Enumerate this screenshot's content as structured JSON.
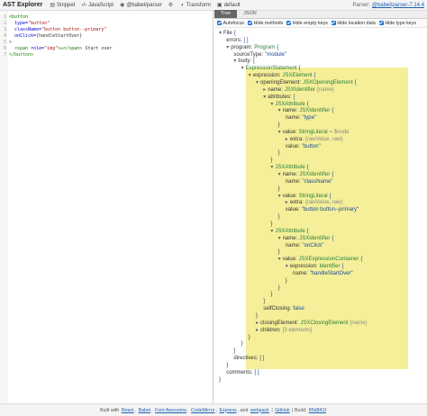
{
  "toolbar": {
    "title": "AST Explorer",
    "snippet": "Snippet",
    "language": "JavaScript",
    "parser_name": "@babel/parser",
    "transform": "Transform",
    "default": "default",
    "parser_label": "Parser:",
    "parser_version": "@babel/parser-7.14.4"
  },
  "editor": {
    "lines": [
      {
        "n": "1",
        "segs": [
          {
            "t": "<button",
            "c": "tag"
          }
        ]
      },
      {
        "n": "2",
        "segs": [
          {
            "t": "  type=",
            "c": "attr"
          },
          {
            "t": "\"button\"",
            "c": "str"
          }
        ]
      },
      {
        "n": "3",
        "segs": [
          {
            "t": "  className=",
            "c": "attr"
          },
          {
            "t": "\"button button--primary\"",
            "c": "str"
          }
        ]
      },
      {
        "n": "4",
        "segs": [
          {
            "t": "  onClick=",
            "c": "attr"
          },
          {
            "t": "{handleStartOver}",
            "c": "brk"
          }
        ]
      },
      {
        "n": "5",
        "segs": [
          {
            "t": ">",
            "c": "tag"
          }
        ]
      },
      {
        "n": "6",
        "segs": [
          {
            "t": "  <span ",
            "c": "tag"
          },
          {
            "t": "role=",
            "c": "attr"
          },
          {
            "t": "\"img\"",
            "c": "str"
          },
          {
            "t": ">↺</span>",
            "c": "tag"
          },
          {
            "t": " Start over",
            "c": "brk"
          }
        ]
      },
      {
        "n": "7",
        "segs": [
          {
            "t": "</button>",
            "c": "tag"
          }
        ]
      }
    ]
  },
  "tabs": {
    "tree": "Tree",
    "json": "JSON"
  },
  "options": [
    "Autofocus",
    "Hide methods",
    "Hide empty keys",
    "Hide location data",
    "Hide type keys"
  ],
  "tree": [
    {
      "d": 0,
      "a": "-",
      "k": "File",
      "t": "",
      "v": "{",
      "m": ""
    },
    {
      "d": 1,
      "a": "",
      "k": "errors:",
      "t": "",
      "v": "[ ]",
      "m": ""
    },
    {
      "d": 1,
      "a": "-",
      "k": "program:",
      "t": "Program",
      "v": "{",
      "m": ""
    },
    {
      "d": 2,
      "a": "",
      "k": "sourceType:",
      "t": "",
      "v": "\"module\"",
      "m": ""
    },
    {
      "d": 2,
      "a": "-",
      "k": "body:",
      "t": "",
      "v": "[",
      "m": ""
    },
    {
      "d": 3,
      "a": "-",
      "k": "",
      "t": "ExpressionStatement",
      "v": "{",
      "m": ""
    },
    {
      "d": 4,
      "a": "-",
      "k": "expression:",
      "t": "JSXElement",
      "v": "{",
      "m": ""
    },
    {
      "d": 5,
      "a": "-",
      "k": "openingElement:",
      "t": "JSXOpeningElement",
      "v": "{",
      "m": ""
    },
    {
      "d": 6,
      "a": "+",
      "k": "name:",
      "t": "JSXIdentifier",
      "v": "",
      "m": "{name}"
    },
    {
      "d": 6,
      "a": "-",
      "k": "attributes:",
      "t": "",
      "v": "[",
      "m": ""
    },
    {
      "d": 7,
      "a": "-",
      "k": "",
      "t": "JSXAttribute",
      "v": "{",
      "m": ""
    },
    {
      "d": 8,
      "a": "-",
      "k": "name:",
      "t": "JSXIdentifier",
      "v": "{",
      "m": ""
    },
    {
      "d": 9,
      "a": "",
      "k": "name:",
      "t": "",
      "v": "\"type\"",
      "m": ""
    },
    {
      "d": 8,
      "a": "",
      "k": "}",
      "t": "",
      "v": "",
      "m": ""
    },
    {
      "d": 8,
      "a": "-",
      "k": "value:",
      "t": "StringLiteral",
      "v": "",
      "m": "= $node"
    },
    {
      "d": 9,
      "a": "+",
      "k": "extra:",
      "t": "",
      "v": "",
      "m": "{rawValue, raw}"
    },
    {
      "d": 9,
      "a": "",
      "k": "value:",
      "t": "",
      "v": "\"button\"",
      "m": ""
    },
    {
      "d": 8,
      "a": "",
      "k": "}",
      "t": "",
      "v": "",
      "m": ""
    },
    {
      "d": 7,
      "a": "",
      "k": "}",
      "t": "",
      "v": "",
      "m": ""
    },
    {
      "d": 7,
      "a": "-",
      "k": "",
      "t": "JSXAttribute",
      "v": "{",
      "m": ""
    },
    {
      "d": 8,
      "a": "-",
      "k": "name:",
      "t": "JSXIdentifier",
      "v": "{",
      "m": ""
    },
    {
      "d": 9,
      "a": "",
      "k": "name:",
      "t": "",
      "v": "\"className\"",
      "m": ""
    },
    {
      "d": 8,
      "a": "",
      "k": "}",
      "t": "",
      "v": "",
      "m": ""
    },
    {
      "d": 8,
      "a": "-",
      "k": "value:",
      "t": "StringLiteral",
      "v": "{",
      "m": ""
    },
    {
      "d": 9,
      "a": "+",
      "k": "extra:",
      "t": "",
      "v": "",
      "m": "{rawValue, raw}"
    },
    {
      "d": 9,
      "a": "",
      "k": "value:",
      "t": "",
      "v": "\"button button--primary\"",
      "m": ""
    },
    {
      "d": 8,
      "a": "",
      "k": "}",
      "t": "",
      "v": "",
      "m": ""
    },
    {
      "d": 7,
      "a": "",
      "k": "}",
      "t": "",
      "v": "",
      "m": ""
    },
    {
      "d": 7,
      "a": "-",
      "k": "",
      "t": "JSXAttribute",
      "v": "{",
      "m": ""
    },
    {
      "d": 8,
      "a": "-",
      "k": "name:",
      "t": "JSXIdentifier",
      "v": "{",
      "m": ""
    },
    {
      "d": 9,
      "a": "",
      "k": "name:",
      "t": "",
      "v": "\"onClick\"",
      "m": ""
    },
    {
      "d": 8,
      "a": "",
      "k": "}",
      "t": "",
      "v": "",
      "m": ""
    },
    {
      "d": 8,
      "a": "-",
      "k": "value:",
      "t": "JSXExpressionContainer",
      "v": "{",
      "m": ""
    },
    {
      "d": 9,
      "a": "-",
      "k": "expression:",
      "t": "Identifier",
      "v": "{",
      "m": ""
    },
    {
      "d": 10,
      "a": "",
      "k": "name:",
      "t": "",
      "v": "\"handleStartOver\"",
      "m": ""
    },
    {
      "d": 9,
      "a": "",
      "k": "}",
      "t": "",
      "v": "",
      "m": ""
    },
    {
      "d": 8,
      "a": "",
      "k": "}",
      "t": "",
      "v": "",
      "m": ""
    },
    {
      "d": 7,
      "a": "",
      "k": "}",
      "t": "",
      "v": "",
      "m": ""
    },
    {
      "d": 6,
      "a": "",
      "k": "]",
      "t": "",
      "v": "",
      "m": ""
    },
    {
      "d": 6,
      "a": "",
      "k": "selfClosing:",
      "t": "",
      "v": "false",
      "m": ""
    },
    {
      "d": 5,
      "a": "",
      "k": "}",
      "t": "",
      "v": "",
      "m": ""
    },
    {
      "d": 5,
      "a": "+",
      "k": "closingElement:",
      "t": "JSXClosingElement",
      "v": "",
      "m": "{name}"
    },
    {
      "d": 5,
      "a": "+",
      "k": "children:",
      "t": "",
      "v": "",
      "m": "[3 elements]"
    },
    {
      "d": 4,
      "a": "",
      "k": "}",
      "t": "",
      "v": "",
      "m": ""
    },
    {
      "d": 3,
      "a": "",
      "k": "}",
      "t": "",
      "v": "",
      "m": ""
    },
    {
      "d": 2,
      "a": "",
      "k": "]",
      "t": "",
      "v": "",
      "m": ""
    },
    {
      "d": 2,
      "a": "",
      "k": "directives:",
      "t": "",
      "v": "[ ]",
      "m": ""
    },
    {
      "d": 1,
      "a": "",
      "k": "}",
      "t": "",
      "v": "",
      "m": ""
    },
    {
      "d": 1,
      "a": "",
      "k": "comments:",
      "t": "",
      "v": "[ ]",
      "m": ""
    },
    {
      "d": 0,
      "a": "",
      "k": "}",
      "t": "",
      "v": "",
      "m": ""
    }
  ],
  "footer": {
    "built_with": "Built with",
    "links": [
      "React",
      "Babel",
      "Font Awesome",
      "CodeMirror",
      "Express",
      "webpack",
      "GitHub",
      "85d841f"
    ],
    "seps": [
      ",",
      ",",
      ",",
      ",",
      ",",
      "and",
      "|",
      "| Build:"
    ]
  },
  "colors": {
    "accent": "#1e6fd9",
    "highlight": "#f4ef98"
  }
}
